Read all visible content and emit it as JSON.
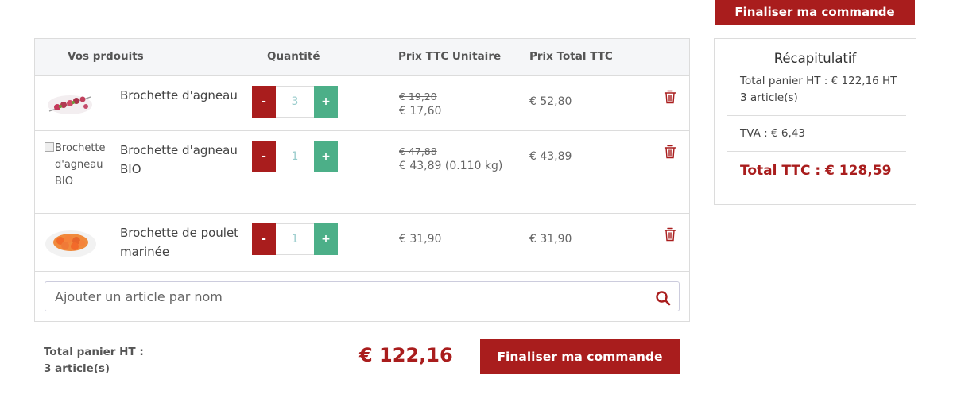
{
  "top_button": {
    "label": "Finaliser ma commande"
  },
  "cart": {
    "headers": {
      "products": "Vos prdouits",
      "quantity": "Quantité",
      "unit_price": "Prix TTC Unitaire",
      "total_price": "Prix Total TTC"
    },
    "rows": [
      {
        "name": "Brochette d'agneau",
        "image_alt": "",
        "quantity": "3",
        "old_price": "€ 19,20",
        "price": "€ 17,60",
        "total": "€ 52,80",
        "minus": "-",
        "plus": "+"
      },
      {
        "name": "Brochette d'agneau BIO",
        "image_alt": "Brochette d'agneau BIO",
        "quantity": "1",
        "old_price": "€ 47,88",
        "price": "€ 43,89 (0.110 kg)",
        "total": "€ 43,89",
        "minus": "-",
        "plus": "+"
      },
      {
        "name": "Brochette de poulet marinée",
        "image_alt": "",
        "quantity": "1",
        "old_price": "",
        "price": "€ 31,90",
        "total": "€ 31,90",
        "minus": "-",
        "plus": "+"
      }
    ],
    "search": {
      "placeholder": "Ajouter un article par nom",
      "icon": "search-icon"
    }
  },
  "bottom": {
    "label_line1": "Total panier HT :",
    "label_line2": "3 article(s)",
    "amount": "€ 122,16",
    "button": "Finaliser ma commande"
  },
  "summary": {
    "title": "Récapitulatif",
    "ht_line": "Total panier HT : € 122,16 HT",
    "articles": "3 article(s)",
    "tva": "TVA : € 6,43",
    "total": "Total TTC : € 128,59"
  },
  "colors": {
    "accent": "#a91d1d",
    "plus": "#4caf88"
  }
}
